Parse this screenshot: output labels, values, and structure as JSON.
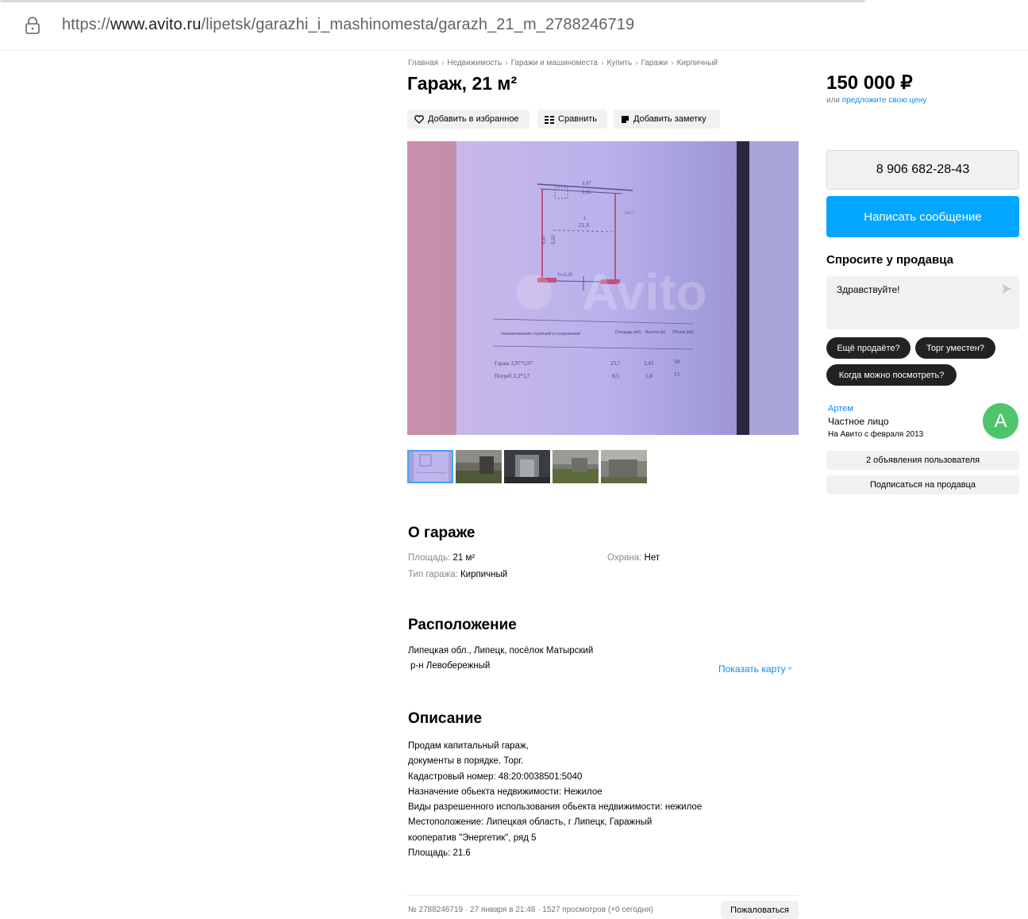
{
  "browser": {
    "url_prefix": "https://",
    "url_domain": "www.avito.ru",
    "url_path": "/lipetsk/garazhi_i_mashinomesta/garazh_21_m_2788246719"
  },
  "breadcrumb": [
    "Главная",
    "Недвижимость",
    "Гаражи и машиноместа",
    "Купить",
    "Гаражи",
    "Кирпичный"
  ],
  "listing": {
    "title": "Гараж, 21 м²",
    "actions": {
      "favorite": "Добавить в избранное",
      "compare": "Сравнить",
      "note": "Добавить заметку"
    },
    "photo_watermark": "Avito",
    "photo_texts": {
      "dim_top1": "3,97",
      "dim_top2": "3,86",
      "area": "21,6",
      "area_label": "1",
      "dim_side1": "5,87",
      "dim_side2": "5,50",
      "height": "h=2,20",
      "lit": "Лит Г",
      "table_header": "Наименование строений и сооружений",
      "col1": "Площадь (м2)",
      "col2": "Высота (м)",
      "col3": "Объем (м3)",
      "row1_name": "Гараж 3,97*5,97",
      "row1_v1": "23,7",
      "row1_v2": "2,45",
      "row1_v3": "58",
      "row2_name": "Погреб 2,3*3,7",
      "row2_v1": "8,5",
      "row2_v2": "1,8",
      "row2_v3": "15"
    },
    "thumbnail_count": 5
  },
  "about": {
    "title": "О гараже",
    "area_label": "Площадь:",
    "area_value": "21 м²",
    "security_label": "Охрана:",
    "security_value": "Нет",
    "type_label": "Тип гаража:",
    "type_value": "Кирпичный"
  },
  "location": {
    "title": "Расположение",
    "address": "Липецкая обл., Липецк, посёлок Матырский",
    "district": "р-н Левобережный",
    "show_map": "Показать карту"
  },
  "description": {
    "title": "Описание",
    "lines": [
      "Продам капитальный гараж,",
      "документы в порядке. Торг.",
      "Кадастровый номер: 48:20:0038501:5040",
      "Назначение обьекта недвижимости: Нежилое",
      "Виды разрешенного использования обьекта недвижимости: нежилое",
      "Местоположение: Липецкая область, г Липецк, Гаражный",
      "кооператив \"Энергетик\", ряд 5",
      "Площадь: 21.6"
    ]
  },
  "footer": {
    "meta": "№ 2788246719 · 27 января в 21:48 · 1527 просмотров (+0 сегодня)",
    "report": "Пожаловаться"
  },
  "sidebar": {
    "price": "150 000 ₽",
    "price_or": "или",
    "price_offer": "предложите свою цену",
    "phone": "8 906 682-28-43",
    "message_button": "Написать сообщение",
    "ask_title": "Спросите у продавца",
    "ask_placeholder": "Здравствуйте!",
    "chips": [
      "Ещё продаёте?",
      "Торг уместен?",
      "Когда можно посмотреть?"
    ],
    "seller": {
      "name": "Артем",
      "type": "Частное лицо",
      "since": "На Авито с февраля 2013",
      "avatar_letter": "А",
      "avatar_color": "#4ec56a"
    },
    "seller_ads": "2 объявления пользователя",
    "subscribe": "Подписаться на продавца"
  },
  "colors": {
    "link": "#0a8cf4",
    "primary_button": "#00a6ff",
    "chip_bg": "#222222",
    "button_bg": "#f2f1f0"
  }
}
